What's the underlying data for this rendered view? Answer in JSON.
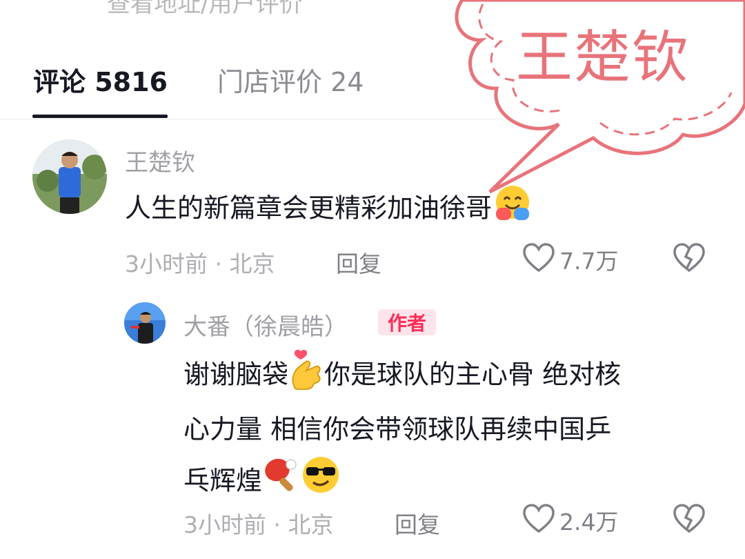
{
  "top_cut_text": "查看地址/用户评价",
  "tabs": {
    "comments_label": "评论 5816",
    "store_reviews_label": "门店评价 24"
  },
  "callout": {
    "text": "王楚钦"
  },
  "comment1": {
    "username": "王楚钦",
    "text": "人生的新篇章会更精彩加油徐哥",
    "meta": "3小时前 · 北京",
    "reply_label": "回复",
    "likes": "7.7万"
  },
  "reply1": {
    "username": "大番（徐晨皓）",
    "badge": "作者",
    "line1": "谢谢脑袋",
    "line1_rest": "你是球队的主心骨 绝对核",
    "line2": "心力量 相信你会带领球队再续中国乒",
    "line3": "乓辉煌",
    "meta": "3小时前 · 北京",
    "reply_label": "回复",
    "likes": "2.4万"
  },
  "colors": {
    "accent": "#fe2c55",
    "callout": "#e8737a"
  }
}
